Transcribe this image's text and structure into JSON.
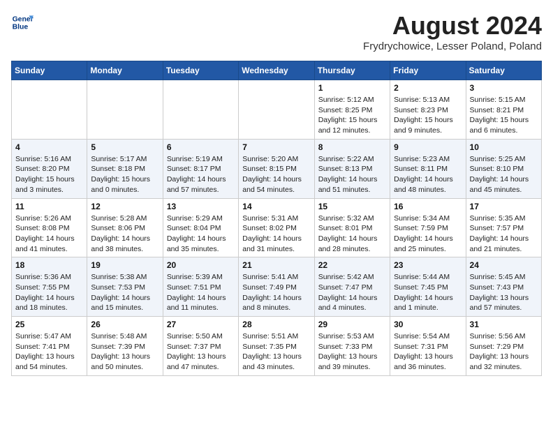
{
  "header": {
    "logo_line1": "General",
    "logo_line2": "Blue",
    "month_title": "August 2024",
    "location": "Frydrychowice, Lesser Poland, Poland"
  },
  "weekdays": [
    "Sunday",
    "Monday",
    "Tuesday",
    "Wednesday",
    "Thursday",
    "Friday",
    "Saturday"
  ],
  "weeks": [
    [
      {
        "day": "",
        "info": ""
      },
      {
        "day": "",
        "info": ""
      },
      {
        "day": "",
        "info": ""
      },
      {
        "day": "",
        "info": ""
      },
      {
        "day": "1",
        "info": "Sunrise: 5:12 AM\nSunset: 8:25 PM\nDaylight: 15 hours\nand 12 minutes."
      },
      {
        "day": "2",
        "info": "Sunrise: 5:13 AM\nSunset: 8:23 PM\nDaylight: 15 hours\nand 9 minutes."
      },
      {
        "day": "3",
        "info": "Sunrise: 5:15 AM\nSunset: 8:21 PM\nDaylight: 15 hours\nand 6 minutes."
      }
    ],
    [
      {
        "day": "4",
        "info": "Sunrise: 5:16 AM\nSunset: 8:20 PM\nDaylight: 15 hours\nand 3 minutes."
      },
      {
        "day": "5",
        "info": "Sunrise: 5:17 AM\nSunset: 8:18 PM\nDaylight: 15 hours\nand 0 minutes."
      },
      {
        "day": "6",
        "info": "Sunrise: 5:19 AM\nSunset: 8:17 PM\nDaylight: 14 hours\nand 57 minutes."
      },
      {
        "day": "7",
        "info": "Sunrise: 5:20 AM\nSunset: 8:15 PM\nDaylight: 14 hours\nand 54 minutes."
      },
      {
        "day": "8",
        "info": "Sunrise: 5:22 AM\nSunset: 8:13 PM\nDaylight: 14 hours\nand 51 minutes."
      },
      {
        "day": "9",
        "info": "Sunrise: 5:23 AM\nSunset: 8:11 PM\nDaylight: 14 hours\nand 48 minutes."
      },
      {
        "day": "10",
        "info": "Sunrise: 5:25 AM\nSunset: 8:10 PM\nDaylight: 14 hours\nand 45 minutes."
      }
    ],
    [
      {
        "day": "11",
        "info": "Sunrise: 5:26 AM\nSunset: 8:08 PM\nDaylight: 14 hours\nand 41 minutes."
      },
      {
        "day": "12",
        "info": "Sunrise: 5:28 AM\nSunset: 8:06 PM\nDaylight: 14 hours\nand 38 minutes."
      },
      {
        "day": "13",
        "info": "Sunrise: 5:29 AM\nSunset: 8:04 PM\nDaylight: 14 hours\nand 35 minutes."
      },
      {
        "day": "14",
        "info": "Sunrise: 5:31 AM\nSunset: 8:02 PM\nDaylight: 14 hours\nand 31 minutes."
      },
      {
        "day": "15",
        "info": "Sunrise: 5:32 AM\nSunset: 8:01 PM\nDaylight: 14 hours\nand 28 minutes."
      },
      {
        "day": "16",
        "info": "Sunrise: 5:34 AM\nSunset: 7:59 PM\nDaylight: 14 hours\nand 25 minutes."
      },
      {
        "day": "17",
        "info": "Sunrise: 5:35 AM\nSunset: 7:57 PM\nDaylight: 14 hours\nand 21 minutes."
      }
    ],
    [
      {
        "day": "18",
        "info": "Sunrise: 5:36 AM\nSunset: 7:55 PM\nDaylight: 14 hours\nand 18 minutes."
      },
      {
        "day": "19",
        "info": "Sunrise: 5:38 AM\nSunset: 7:53 PM\nDaylight: 14 hours\nand 15 minutes."
      },
      {
        "day": "20",
        "info": "Sunrise: 5:39 AM\nSunset: 7:51 PM\nDaylight: 14 hours\nand 11 minutes."
      },
      {
        "day": "21",
        "info": "Sunrise: 5:41 AM\nSunset: 7:49 PM\nDaylight: 14 hours\nand 8 minutes."
      },
      {
        "day": "22",
        "info": "Sunrise: 5:42 AM\nSunset: 7:47 PM\nDaylight: 14 hours\nand 4 minutes."
      },
      {
        "day": "23",
        "info": "Sunrise: 5:44 AM\nSunset: 7:45 PM\nDaylight: 14 hours\nand 1 minute."
      },
      {
        "day": "24",
        "info": "Sunrise: 5:45 AM\nSunset: 7:43 PM\nDaylight: 13 hours\nand 57 minutes."
      }
    ],
    [
      {
        "day": "25",
        "info": "Sunrise: 5:47 AM\nSunset: 7:41 PM\nDaylight: 13 hours\nand 54 minutes."
      },
      {
        "day": "26",
        "info": "Sunrise: 5:48 AM\nSunset: 7:39 PM\nDaylight: 13 hours\nand 50 minutes."
      },
      {
        "day": "27",
        "info": "Sunrise: 5:50 AM\nSunset: 7:37 PM\nDaylight: 13 hours\nand 47 minutes."
      },
      {
        "day": "28",
        "info": "Sunrise: 5:51 AM\nSunset: 7:35 PM\nDaylight: 13 hours\nand 43 minutes."
      },
      {
        "day": "29",
        "info": "Sunrise: 5:53 AM\nSunset: 7:33 PM\nDaylight: 13 hours\nand 39 minutes."
      },
      {
        "day": "30",
        "info": "Sunrise: 5:54 AM\nSunset: 7:31 PM\nDaylight: 13 hours\nand 36 minutes."
      },
      {
        "day": "31",
        "info": "Sunrise: 5:56 AM\nSunset: 7:29 PM\nDaylight: 13 hours\nand 32 minutes."
      }
    ]
  ]
}
